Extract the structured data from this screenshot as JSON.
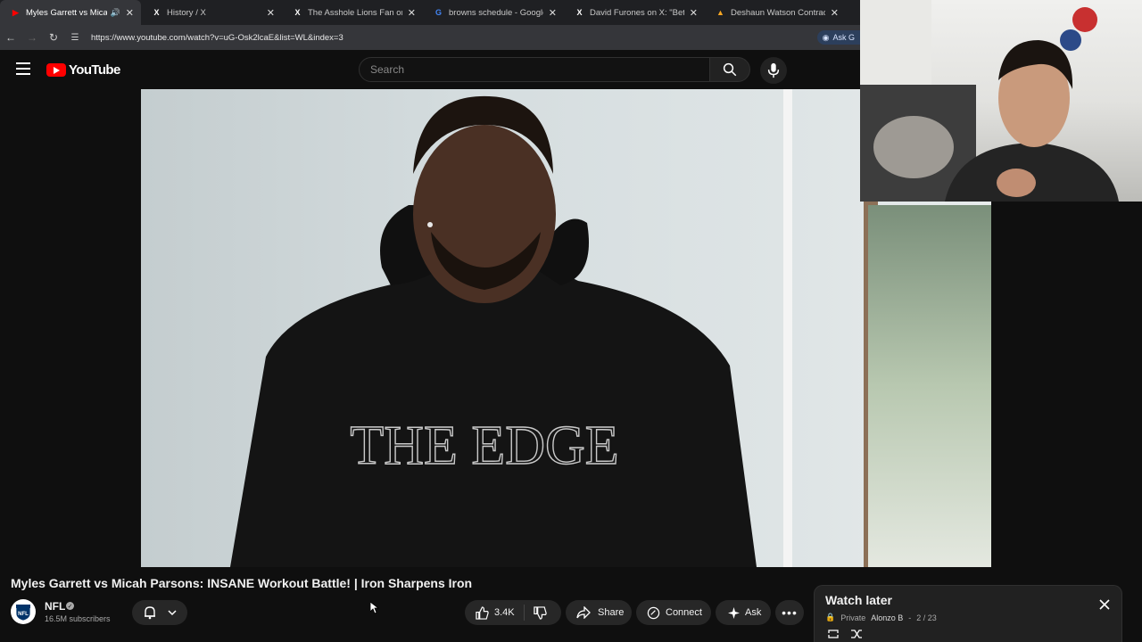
{
  "browser": {
    "tabs": [
      {
        "label": "Myles Garrett vs Micah Pars",
        "favicon": "youtube-icon",
        "active": true,
        "audio": true
      },
      {
        "label": "History / X",
        "favicon": "x-icon",
        "active": false
      },
      {
        "label": "The Asshole Lions Fan on X: \"h",
        "favicon": "x-icon",
        "active": false
      },
      {
        "label": "browns schedule - Google Sear",
        "favicon": "google-icon",
        "active": false
      },
      {
        "label": "David Furones on X: \"BetMGM",
        "favicon": "x-icon",
        "active": false
      },
      {
        "label": "Deshaun Watson Contract, Sala",
        "favicon": "site-icon",
        "active": false
      }
    ],
    "url": "https://www.youtube.com/watch?v=uG-Osk2lcaE&list=WL&index=3",
    "ask_button": "Ask G"
  },
  "youtube": {
    "logo_text": "YouTube",
    "search_placeholder": "Search"
  },
  "video": {
    "title": "Myles Garrett vs Micah Parsons: INSANE Workout Battle! | Iron Sharpens Iron",
    "hoodie_text": "THE EDGE",
    "channel": {
      "name": "NFL",
      "subscribers": "16.5M subscribers"
    },
    "actions": {
      "likes": "3.4K",
      "share": "Share",
      "connect": "Connect",
      "ask": "Ask"
    }
  },
  "playlist": {
    "title": "Watch later",
    "privacy": "Private",
    "owner": "Alonzo B",
    "position": "2 / 23"
  },
  "colors": {
    "accent": "#ff0000",
    "background": "#0f0f0f",
    "pill": "#272727"
  }
}
